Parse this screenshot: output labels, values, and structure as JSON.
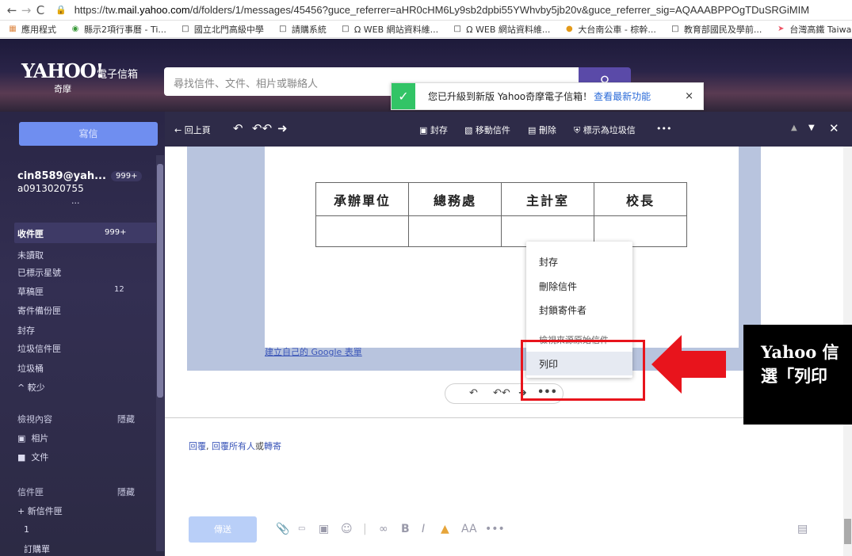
{
  "browser": {
    "url_prefix": "https://tw.",
    "url_host": "mail.yahoo.com",
    "url_rest": "/d/folders/1/messages/45456?guce_referrer=aHR0cHM6Ly9sb2dpbi55YWhvby5jb20v&guce_referrer_sig=AQAAABPPOgTDuSRGiMIM",
    "bookmarks": [
      {
        "label": "應用程式",
        "icon": "apps-grid-icon"
      },
      {
        "label": "縣示2項行事曆 - Ti...",
        "icon": "circle-icon"
      },
      {
        "label": "國立北門高級中學",
        "icon": "page-icon"
      },
      {
        "label": "請購系統",
        "icon": "page-icon"
      },
      {
        "label": "Ω WEB 網站資料維...",
        "icon": "page-icon"
      },
      {
        "label": "Ω WEB 網站資料維...",
        "icon": "page-icon"
      },
      {
        "label": "大台南公車 - 棕幹...",
        "icon": "bus-icon"
      },
      {
        "label": "教育部國民及學前...",
        "icon": "page-icon"
      },
      {
        "label": "台灣高鐵 Taiwa",
        "icon": "train-icon"
      }
    ]
  },
  "header": {
    "logo": "YAHOO!",
    "logo_sub": "奇摩",
    "product": "電子信箱",
    "search_placeholder": "尋找信件、文件、相片或聯絡人"
  },
  "toast": {
    "message": "您已升級到新版 Yahoo奇摩電子信箱！",
    "link": "查看最新功能",
    "close": "×"
  },
  "sidebar": {
    "compose": "寫信",
    "account_email": "cin8589@yah...",
    "account_badge": "999+",
    "account_2": "a0913020755",
    "more": "...",
    "folders": [
      {
        "label": "收件匣",
        "count": "999+"
      },
      {
        "label": "未讀取",
        "count": ""
      },
      {
        "label": "已標示星號",
        "count": ""
      },
      {
        "label": "草稿匣",
        "count": "12"
      },
      {
        "label": "寄件備份匣",
        "count": ""
      },
      {
        "label": "封存",
        "count": ""
      },
      {
        "label": "垃圾信件匣",
        "count": ""
      },
      {
        "label": "垃圾桶",
        "count": ""
      },
      {
        "label": "^ 較少",
        "count": ""
      }
    ],
    "views_head": "檢視內容",
    "views_hide": "隱藏",
    "views": [
      "相片",
      "文件"
    ],
    "mailbox_head": "信件匣",
    "mailbox_hide": "隱藏",
    "new_folder": "+ 新信件匣",
    "folder_1": "1",
    "folder_2": "訂購單"
  },
  "toolbar": {
    "back": "← 回上頁",
    "archive": "封存",
    "move": "移動信件",
    "delete": "刪除",
    "spam": "標示為垃圾信",
    "more": "•••"
  },
  "doc": {
    "table_headers": [
      "承辦單位",
      "總務處",
      "主計室",
      "校長"
    ],
    "google_form_link": "建立自己的 Google 表單"
  },
  "context_menu": {
    "items": [
      "封存",
      "刪除信件",
      "封鎖寄件者",
      "檢視來源原始信件",
      "列印"
    ],
    "highlighted": "列印"
  },
  "reply": {
    "reply": "回覆",
    "reply_all": "回覆所有人",
    "or": "或",
    "forward": "轉寄",
    "send": "傳送"
  },
  "annotation": {
    "line1": "Yahoo 信",
    "line2": "選「列印"
  },
  "colors": {
    "accent": "#5a4aa8",
    "highlight_red": "#e8141c",
    "toast_green": "#32c466"
  }
}
